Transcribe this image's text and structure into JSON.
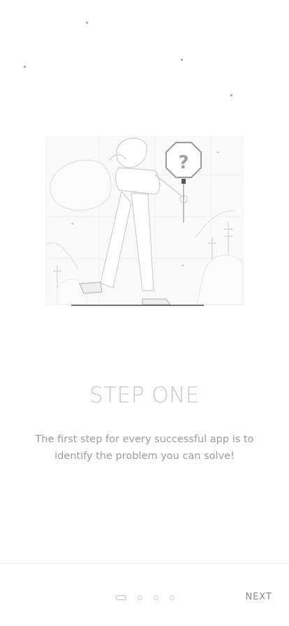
{
  "onboarding": {
    "title": "STEP ONE",
    "description": "The first step for every successful app is to identify the problem you can solve!",
    "illustration_icon": "question-sign-woman-illustration",
    "sign_glyph": "?",
    "pager": {
      "total": 4,
      "current": 1
    },
    "next_label": "NEXT"
  }
}
